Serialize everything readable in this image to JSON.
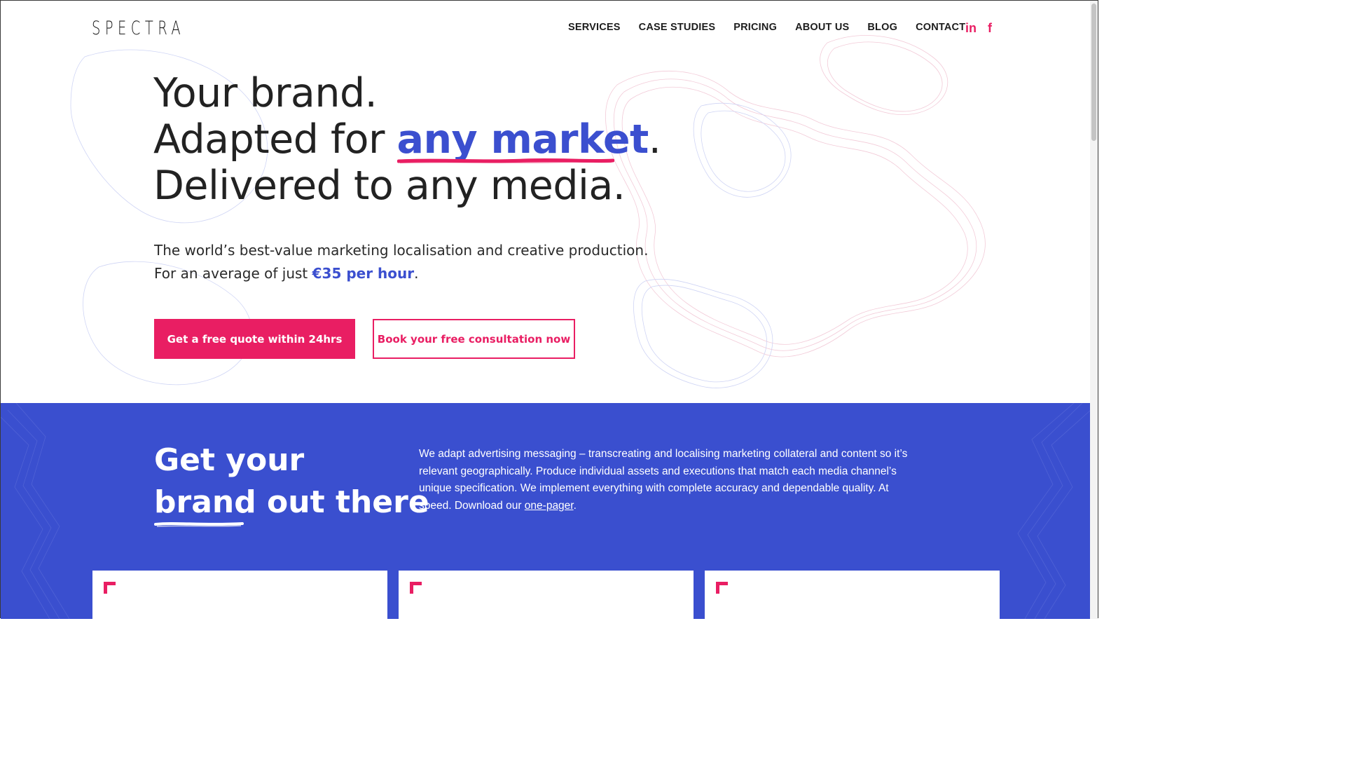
{
  "brand": {
    "logo": "SPECTRA"
  },
  "nav": {
    "items": [
      "SERVICES",
      "CASE STUDIES",
      "PRICING",
      "ABOUT US",
      "BLOG",
      "CONTACT"
    ],
    "social": {
      "linkedin": "in",
      "facebook": "f"
    }
  },
  "hero": {
    "line1": "Your brand.",
    "line2_prefix": "Adapted for ",
    "line2_accent": "any market",
    "line2_suffix": ".",
    "line3": "Delivered to any media.",
    "sub_line1": "The world’s best-value marketing localisation and creative production.",
    "sub_line2_prefix": "For an average of just ",
    "sub_line2_price": "€35 per hour",
    "sub_line2_suffix": ".",
    "cta_primary": "Get a free quote within 24hrs",
    "cta_secondary": "Book your free consultation now"
  },
  "band": {
    "title_line1": "Get your",
    "title_word_underlined": "brand",
    "title_line2_rest": " out there",
    "text": "We adapt advertising messaging – transcreating and localising marketing collateral and content so it’s relevant geographically. Produce individual assets and executions that match each media channel’s unique specification. We implement everything with complete accuracy and dependable quality. At speed. Download our ",
    "link": "one-pager",
    "text_end": "."
  },
  "colors": {
    "accent_blue": "#3b4fcf",
    "accent_pink": "#e91e63",
    "band_bg": "#3a4fcf"
  },
  "icons": [
    "linkedin-icon",
    "facebook-icon",
    "corner-bracket-icon"
  ]
}
